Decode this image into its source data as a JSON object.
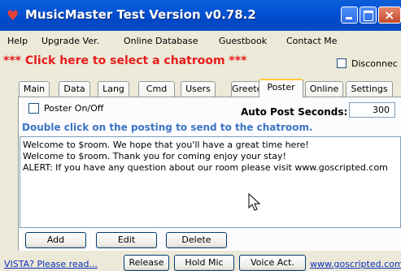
{
  "window": {
    "title": "MusicMaster Test Version v0.78.2",
    "accent_color": "#0353d6",
    "icons": [
      "heart-icon",
      "minimize-icon",
      "maximize-icon",
      "close-icon"
    ]
  },
  "menu": {
    "items": [
      "Help",
      "Upgrade Ver.",
      "Online Database",
      "Guestbook",
      "Contact Me"
    ]
  },
  "chatroom": {
    "select_label": "*** Click here to select a chatroom ***",
    "disconnect_label": "Disconnec",
    "disconnect_checked": false,
    "link_color": "#e81b1b"
  },
  "tabs": {
    "items": [
      "Main",
      "Data",
      "Lang",
      "Cmd",
      "Users",
      "Greeter",
      "Poster",
      "Online",
      "Settings"
    ],
    "active": "Poster"
  },
  "poster": {
    "onoff_label": "Poster On/Off",
    "onoff_checked": false,
    "auto_post_label": "Auto Post Seconds:",
    "auto_post_value": "300",
    "hint": "Double click on the posting to send to the chatroom.",
    "postings": [
      "Welcome to $room.  We hope that you'll have a great time here!",
      "Welcome to $room.  Thank you for coming enjoy your stay!",
      "ALERT: If you have any question about our room please visit www.goscripted.com"
    ],
    "buttons": {
      "add": "Add",
      "edit": "Edit",
      "delete": "Delete"
    }
  },
  "footer": {
    "vista_link": "VISTA? Please read...",
    "release_button": "Release",
    "hold_mic_button": "Hold Mic",
    "voice_act_button": "Voice Act.",
    "site_link": "www.goscripted.com"
  }
}
